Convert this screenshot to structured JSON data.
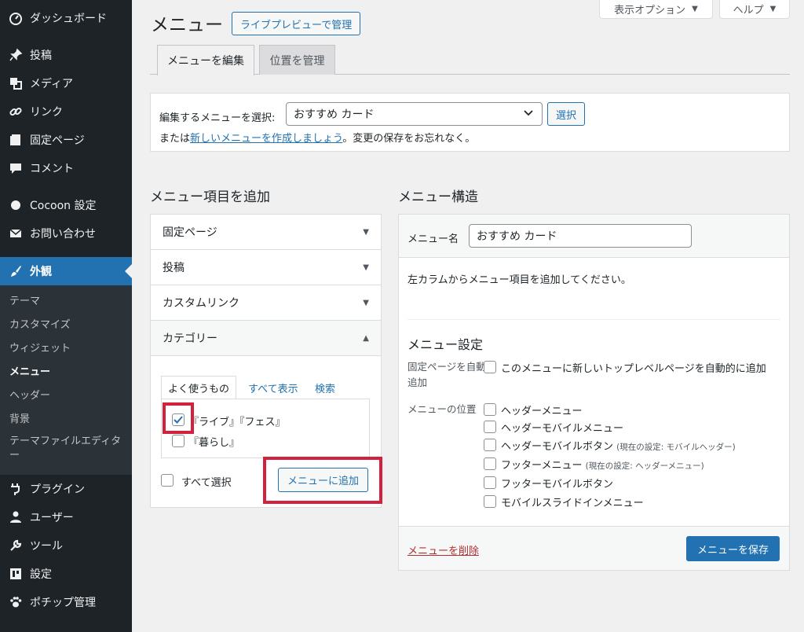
{
  "sidebar": {
    "items": [
      {
        "label": "ダッシュボード",
        "icon": "dashboard-icon"
      },
      {
        "label": "投稿",
        "icon": "pin-icon"
      },
      {
        "label": "メディア",
        "icon": "media-icon"
      },
      {
        "label": "リンク",
        "icon": "link-icon"
      },
      {
        "label": "固定ページ",
        "icon": "page-icon"
      },
      {
        "label": "コメント",
        "icon": "comment-icon"
      },
      {
        "label": "Cocoon 設定",
        "icon": "circle-icon"
      },
      {
        "label": "お問い合わせ",
        "icon": "mail-icon"
      },
      {
        "label": "外観",
        "icon": "paintbrush-icon"
      },
      {
        "label": "プラグイン",
        "icon": "plugin-icon"
      },
      {
        "label": "ユーザー",
        "icon": "user-icon"
      },
      {
        "label": "ツール",
        "icon": "wrench-icon"
      },
      {
        "label": "設定",
        "icon": "settings-icon"
      },
      {
        "label": "ポチップ管理",
        "icon": "paw-icon"
      }
    ],
    "submenu": [
      "テーマ",
      "カスタマイズ",
      "ウィジェット",
      "メニュー",
      "ヘッダー",
      "背景",
      "テーマファイルエディター"
    ]
  },
  "header": {
    "screen_options": "表示オプション",
    "help": "ヘルプ",
    "title": "メニュー",
    "live_preview": "ライブプレビューで管理",
    "tabs": [
      "メニューを編集",
      "位置を管理"
    ]
  },
  "manage": {
    "select_label": "編集するメニューを選択:",
    "selected_menu": "おすすめ カード",
    "select_button": "選択",
    "or_prefix": "または",
    "create_link": "新しいメニューを作成しましょう",
    "or_suffix": "。変更の保存をお忘れなく。"
  },
  "add_items": {
    "heading": "メニュー項目を追加",
    "sections": [
      "固定ページ",
      "投稿",
      "カスタムリンク",
      "カテゴリー"
    ],
    "category_tabs": [
      "よく使うもの",
      "すべて表示",
      "検索"
    ],
    "categories": [
      {
        "label": "『ライブ』『フェス』",
        "checked": true
      },
      {
        "label": "『暮らし』",
        "checked": false
      }
    ],
    "select_all": "すべて選択",
    "add_button": "メニューに追加"
  },
  "structure": {
    "heading": "メニュー構造",
    "name_label": "メニュー名",
    "name_value": "おすすめ カード",
    "instruction": "左カラムからメニュー項目を追加してください。",
    "settings_title": "メニュー設定",
    "auto_add_label": "固定ページを自動追加",
    "auto_add_option": "このメニューに新しいトップレベルページを自動的に追加",
    "location_label": "メニューの位置",
    "locations": [
      {
        "label": "ヘッダーメニュー",
        "note": ""
      },
      {
        "label": "ヘッダーモバイルメニュー",
        "note": ""
      },
      {
        "label": "ヘッダーモバイルボタン",
        "note": "(現在の設定: モバイルヘッダー)"
      },
      {
        "label": "フッターメニュー",
        "note": "(現在の設定: ヘッダーメニュー)"
      },
      {
        "label": "フッターモバイルボタン",
        "note": ""
      },
      {
        "label": "モバイルスライドインメニュー",
        "note": ""
      }
    ],
    "delete_link": "メニューを削除",
    "save_button": "メニューを保存"
  }
}
